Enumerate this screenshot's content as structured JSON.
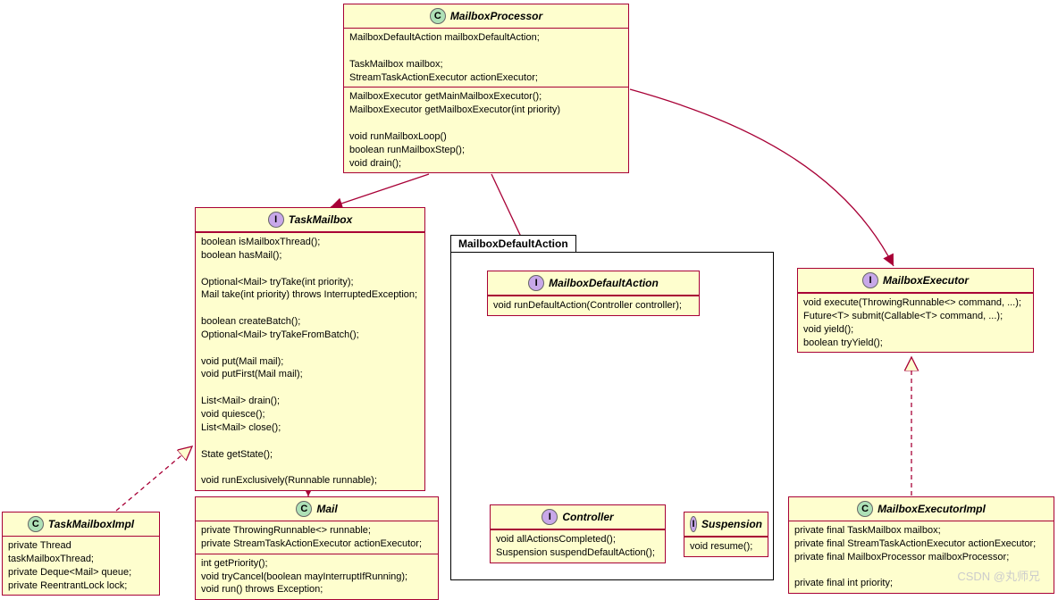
{
  "classes": {
    "mailboxProcessor": {
      "name": "MailboxProcessor",
      "stereo": "C",
      "sections": [
        [
          "MailboxDefaultAction mailboxDefaultAction;",
          "",
          "TaskMailbox mailbox;",
          "StreamTaskActionExecutor actionExecutor;"
        ],
        [
          "MailboxExecutor getMainMailboxExecutor();",
          "MailboxExecutor getMailboxExecutor(int priority)",
          "",
          "void runMailboxLoop()",
          "boolean runMailboxStep();",
          "void drain();"
        ]
      ]
    },
    "taskMailbox": {
      "name": "TaskMailbox",
      "stereo": "I",
      "sections": [
        [
          "boolean isMailboxThread();",
          "boolean hasMail();",
          "",
          "Optional<Mail> tryTake(int priority);",
          "Mail take(int priority) throws InterruptedException;",
          "",
          "boolean createBatch();",
          "Optional<Mail> tryTakeFromBatch();",
          "",
          "void put(Mail mail);",
          "void putFirst(Mail mail);",
          "",
          "List<Mail> drain();",
          "void quiesce();",
          "List<Mail> close();",
          "",
          "State getState();",
          "",
          "void runExclusively(Runnable runnable);"
        ]
      ]
    },
    "taskMailboxImpl": {
      "name": "TaskMailboxImpl",
      "stereo": "C",
      "sections": [
        [
          "private Thread taskMailboxThread;",
          "private Deque<Mail> queue;",
          "private ReentrantLock lock;"
        ]
      ]
    },
    "mail": {
      "name": "Mail",
      "stereo": "C",
      "sections": [
        [
          "private ThrowingRunnable<> runnable;",
          "private StreamTaskActionExecutor actionExecutor;"
        ],
        [
          "int getPriority();",
          "void tryCancel(boolean mayInterruptIfRunning);",
          "void run() throws Exception;"
        ]
      ]
    },
    "mailboxDefaultAction": {
      "name": "MailboxDefaultAction",
      "stereo": "I",
      "sections": [
        [
          "void runDefaultAction(Controller controller);"
        ]
      ]
    },
    "controller": {
      "name": "Controller",
      "stereo": "I",
      "sections": [
        [
          "void allActionsCompleted();",
          "Suspension suspendDefaultAction();"
        ]
      ]
    },
    "suspension": {
      "name": "Suspension",
      "stereo": "I",
      "sections": [
        [
          "void resume();"
        ]
      ]
    },
    "mailboxExecutor": {
      "name": "MailboxExecutor",
      "stereo": "I",
      "sections": [
        [
          "void execute(ThrowingRunnable<> command, ...);",
          "Future<T> submit(Callable<T> command, ...);",
          "void yield();",
          "boolean tryYield();"
        ]
      ]
    },
    "mailboxExecutorImpl": {
      "name": "MailboxExecutorImpl",
      "stereo": "C",
      "sections": [
        [
          "private final TaskMailbox mailbox;",
          "private final StreamTaskActionExecutor actionExecutor;",
          "private final MailboxProcessor mailboxProcessor;",
          "",
          "private final int priority;"
        ]
      ]
    }
  },
  "package": {
    "name": "MailboxDefaultAction"
  },
  "watermark": "CSDN @丸师兄"
}
